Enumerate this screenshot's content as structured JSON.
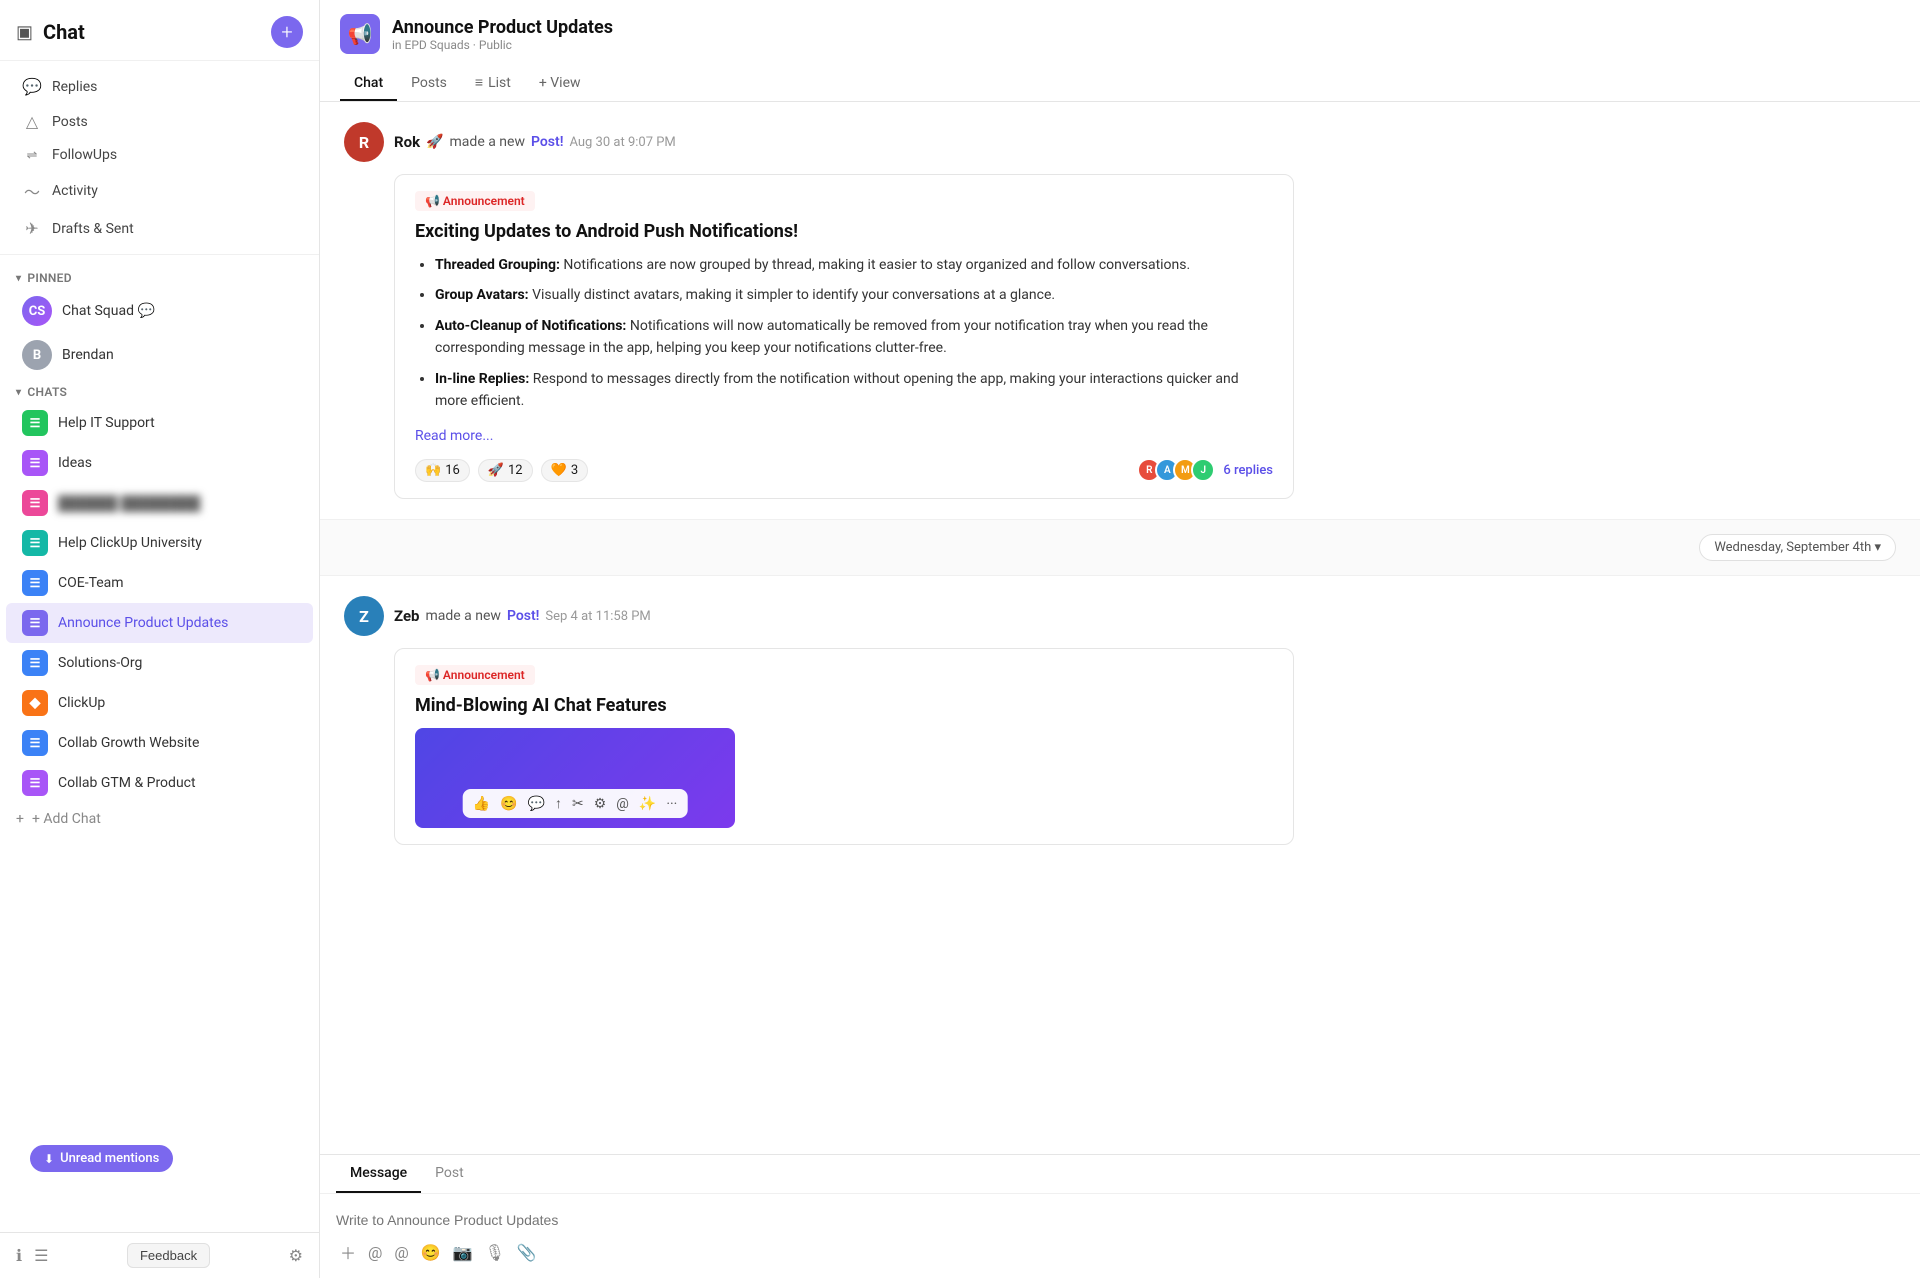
{
  "sidebar": {
    "title": "Chat",
    "add_button_label": "+",
    "nav_items": [
      {
        "id": "replies",
        "label": "Replies",
        "icon": "💬"
      },
      {
        "id": "posts",
        "label": "Posts",
        "icon": "△"
      },
      {
        "id": "followups",
        "label": "FollowUps",
        "icon": "⇌"
      },
      {
        "id": "activity",
        "label": "Activity",
        "icon": "〜"
      },
      {
        "id": "drafts",
        "label": "Drafts & Sent",
        "icon": "✈"
      }
    ],
    "pinned_label": "Pinned",
    "pinned_items": [
      {
        "id": "chat-squad",
        "label": "Chat Squad 💬",
        "color": "#7b68ee"
      },
      {
        "id": "brendan",
        "label": "Brendan",
        "color": "#9ca3af"
      }
    ],
    "chats_label": "Chats",
    "chat_items": [
      {
        "id": "help-it",
        "label": "Help IT Support",
        "color": "#22c55e",
        "icon": "☰"
      },
      {
        "id": "ideas",
        "label": "Ideas",
        "color": "#a855f7",
        "icon": "☰"
      },
      {
        "id": "blurred",
        "label": "██████ ████████",
        "color": "#ec4899",
        "icon": "☰",
        "blurred": true
      },
      {
        "id": "help-clickup",
        "label": "Help ClickUp University",
        "color": "#14b8a6",
        "icon": "☰"
      },
      {
        "id": "coe-team",
        "label": "COE-Team",
        "color": "#6366f1",
        "icon": "☰"
      },
      {
        "id": "announce",
        "label": "Announce Product Updates",
        "color": "#7b68ee",
        "icon": "☰",
        "active": true
      },
      {
        "id": "solutions-org",
        "label": "Solutions-Org",
        "color": "#6366f1",
        "icon": "☰"
      },
      {
        "id": "clickup",
        "label": "ClickUp",
        "color": "#f97316",
        "icon": "◆"
      },
      {
        "id": "collab-growth",
        "label": "Collab Growth Website",
        "color": "#6366f1",
        "icon": "☰"
      },
      {
        "id": "collab-gtm",
        "label": "Collab GTM & Product",
        "color": "#a855f7",
        "icon": "☰"
      }
    ],
    "add_chat_label": "+ Add Chat",
    "unread_mentions_label": "Unread mentions",
    "footer": {
      "feedback_label": "Feedback"
    }
  },
  "channel": {
    "name": "Announce Product Updates",
    "subtitle": "in EPD Squads · Public",
    "icon": "📢"
  },
  "tabs": [
    {
      "id": "chat",
      "label": "Chat",
      "active": true
    },
    {
      "id": "posts",
      "label": "Posts"
    },
    {
      "id": "list",
      "label": "List",
      "icon": "≡"
    },
    {
      "id": "view",
      "label": "+ View"
    }
  ],
  "messages": [
    {
      "id": "msg1",
      "sender": "Rok",
      "sender_emoji": "🚀",
      "action": "made a new",
      "post_label": "Post!",
      "time": "Aug 30 at 9:07 PM",
      "avatar_color": "#c0392b",
      "avatar_text": "R",
      "announcement_tag": "📢 Announcement",
      "title": "Exciting Updates to Android Push Notifications!",
      "bullets": [
        {
          "bold": "Threaded Grouping:",
          "text": " Notifications are now grouped by thread, making it easier to stay organized and follow conversations."
        },
        {
          "bold": "Group Avatars:",
          "text": " Visually distinct avatars, making it simpler to identify your conversations at a glance."
        },
        {
          "bold": "Auto-Cleanup of Notifications:",
          "text": " Notifications will now automatically be removed from your notification tray when you read the corresponding message in the app, helping you keep your notifications clutter-free."
        },
        {
          "bold": "In-line Replies:",
          "text": " Respond to messages directly from the notification without opening the app, making your interactions quicker and more efficient."
        }
      ],
      "read_more": "Read more...",
      "reactions": [
        {
          "emoji": "🙌",
          "count": "16"
        },
        {
          "emoji": "🚀",
          "count": "12"
        },
        {
          "emoji": "🧡",
          "count": "3"
        }
      ],
      "reply_avatars": [
        "#e74c3c",
        "#3498db",
        "#f39c12",
        "#2ecc71"
      ],
      "replies_text": "6 replies"
    },
    {
      "id": "msg2",
      "sender": "Zeb",
      "action": "made a new",
      "post_label": "Post!",
      "time": "Sep 4 at 11:58 PM",
      "avatar_color": "#2980b9",
      "avatar_text": "Z",
      "announcement_tag": "📢 Announcement",
      "title": "Mind-Blowing AI Chat Features"
    }
  ],
  "date_divider": "Wednesday, September 4th ▾",
  "input": {
    "message_tab": "Message",
    "post_tab": "Post",
    "placeholder": "Write to Announce Product Updates",
    "toolbar_icons": [
      "+",
      "@",
      "@",
      "😊",
      "📷",
      "🎙",
      "📎"
    ]
  }
}
